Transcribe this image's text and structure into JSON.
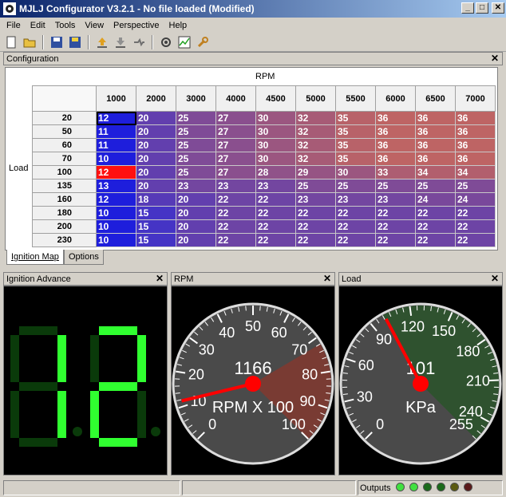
{
  "window": {
    "title": "MJLJ Configurator V3.2.1 - No file loaded (Modified)",
    "min": "_",
    "max": "□",
    "close": "✕"
  },
  "menu": [
    "File",
    "Edit",
    "Tools",
    "View",
    "Perspective",
    "Help"
  ],
  "toolbar_icons": [
    "app-logo-icon",
    "open-folder-icon",
    "save-icon",
    "save-as-icon",
    "upload-icon",
    "download-icon",
    "connect-icon",
    "settings-icon",
    "chart-icon",
    "wrench-icon"
  ],
  "config": {
    "title": "Configuration",
    "close": "✕",
    "rpm_label": "RPM",
    "load_label": "Load",
    "tabs": [
      "Ignition Map",
      "Options"
    ]
  },
  "ignition_map": {
    "rpm": [
      "1000",
      "2000",
      "3000",
      "4000",
      "4500",
      "5000",
      "5500",
      "6000",
      "6500",
      "7000"
    ],
    "load": [
      "20",
      "50",
      "60",
      "70",
      "100",
      "135",
      "160",
      "180",
      "200",
      "230"
    ],
    "values": [
      [
        12,
        20,
        25,
        27,
        30,
        32,
        35,
        36,
        36,
        36
      ],
      [
        11,
        20,
        25,
        27,
        30,
        32,
        35,
        36,
        36,
        36
      ],
      [
        11,
        20,
        25,
        27,
        30,
        32,
        35,
        36,
        36,
        36
      ],
      [
        10,
        20,
        25,
        27,
        30,
        32,
        35,
        36,
        36,
        36
      ],
      [
        12,
        20,
        25,
        27,
        28,
        29,
        30,
        33,
        34,
        34
      ],
      [
        13,
        20,
        23,
        23,
        23,
        25,
        25,
        25,
        25,
        25
      ],
      [
        12,
        18,
        20,
        22,
        22,
        23,
        23,
        23,
        24,
        24
      ],
      [
        10,
        15,
        20,
        22,
        22,
        22,
        22,
        22,
        22,
        22
      ],
      [
        10,
        15,
        20,
        22,
        22,
        22,
        22,
        22,
        22,
        22
      ],
      [
        10,
        15,
        20,
        22,
        22,
        22,
        22,
        22,
        22,
        22
      ]
    ],
    "selected_cell": {
      "row": 0,
      "col": 0
    },
    "active_cell": {
      "row": 4,
      "col": 0
    }
  },
  "ign_panel": {
    "title": "Ignition Advance",
    "close": "✕",
    "value": "12"
  },
  "rpm_gauge": {
    "title": "RPM",
    "close": "✕",
    "value": "1166",
    "unit": "RPM X 100",
    "ticks": [
      "0",
      "10",
      "20",
      "30",
      "40",
      "50",
      "60",
      "70",
      "80",
      "90",
      "100"
    ],
    "min": 0,
    "max": 100,
    "needle": 11.66
  },
  "load_gauge": {
    "title": "Load",
    "close": "✕",
    "value": "101",
    "unit": "KPa",
    "ticks": [
      "0",
      "30",
      "60",
      "90",
      "120",
      "150",
      "180",
      "210",
      "240",
      "255"
    ],
    "min": 0,
    "max": 255,
    "needle": 101
  },
  "status": {
    "outputs_label": "Outputs",
    "leds": [
      "#40e040",
      "#40e040",
      "#1a6a1a",
      "#1a6a1a",
      "#5a5a10",
      "#5a1a1a"
    ]
  }
}
